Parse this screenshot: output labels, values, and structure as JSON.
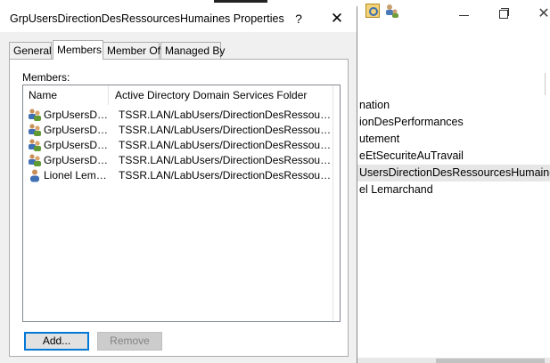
{
  "background_window": {
    "list_items": [
      {
        "label": "nation",
        "selected": false
      },
      {
        "label": "ionDesPerformances",
        "selected": false
      },
      {
        "label": "utement",
        "selected": false
      },
      {
        "label": "eEtSecuriteAuTravail",
        "selected": false
      },
      {
        "label": "UsersDirectionDesRessourcesHumaines",
        "selected": true
      },
      {
        "label": "el Lemarchand",
        "selected": false
      }
    ]
  },
  "dialog": {
    "title": "GrpUsersDirectionDesRessourcesHumaines Properties",
    "help_label": "?",
    "close_label": "✕",
    "tabs": [
      {
        "label": "General",
        "active": false
      },
      {
        "label": "Members",
        "active": true
      },
      {
        "label": "Member Of",
        "active": false
      },
      {
        "label": "Managed By",
        "active": false
      }
    ],
    "members_label": "Members:",
    "columns": {
      "name": "Name",
      "folder": "Active Directory Domain Services Folder"
    },
    "members": [
      {
        "icon": "group-icon",
        "name": "GrpUsersDire...",
        "folder": "TSSR.LAN/LabUsers/DirectionDesRessources..."
      },
      {
        "icon": "group-icon",
        "name": "GrpUsersDire...",
        "folder": "TSSR.LAN/LabUsers/DirectionDesRessources..."
      },
      {
        "icon": "group-icon",
        "name": "GrpUsersDire...",
        "folder": "TSSR.LAN/LabUsers/DirectionDesRessources..."
      },
      {
        "icon": "group-icon",
        "name": "GrpUsersDire...",
        "folder": "TSSR.LAN/LabUsers/DirectionDesRessources..."
      },
      {
        "icon": "user-icon",
        "name": "Lionel Lemarc...",
        "folder": "TSSR.LAN/LabUsers/DirectionDesRessources..."
      }
    ],
    "buttons": {
      "add": "Add...",
      "remove": "Remove"
    }
  }
}
